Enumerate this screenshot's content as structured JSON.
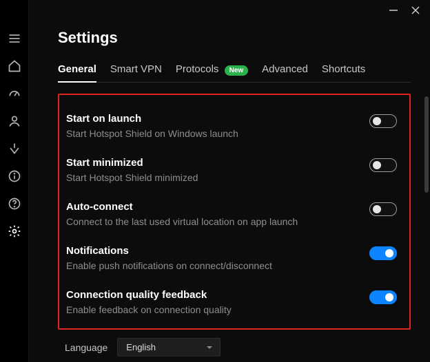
{
  "page_title": "Settings",
  "tabs": {
    "general": "General",
    "smartvpn": "Smart VPN",
    "protocols": "Protocols",
    "protocols_badge": "New",
    "advanced": "Advanced",
    "shortcuts": "Shortcuts"
  },
  "settings": {
    "start_on_launch": {
      "title": "Start on launch",
      "sub": "Start Hotspot Shield on Windows launch",
      "on": false
    },
    "start_minimized": {
      "title": "Start minimized",
      "sub": "Start Hotspot Shield minimized",
      "on": false
    },
    "auto_connect": {
      "title": "Auto-connect",
      "sub": "Connect to the last used virtual location on app launch",
      "on": false
    },
    "notifications": {
      "title": "Notifications",
      "sub": "Enable push notifications on connect/disconnect",
      "on": true
    },
    "quality": {
      "title": "Connection quality feedback",
      "sub": "Enable feedback on connection quality",
      "on": true
    }
  },
  "language": {
    "label": "Language",
    "value": "English"
  }
}
